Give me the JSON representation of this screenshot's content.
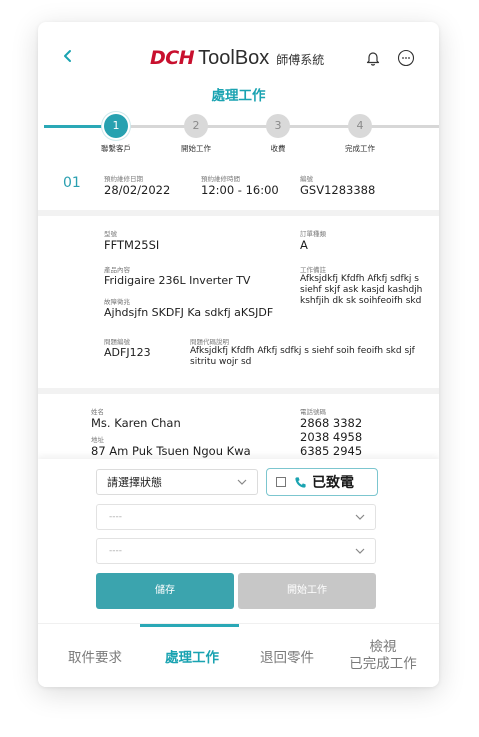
{
  "header": {
    "brand_dch": "DCH",
    "brand_toolbox": "ToolBox",
    "brand_sub": "師傅系統",
    "title": "處理工作"
  },
  "stepper": {
    "current": 1,
    "steps": [
      {
        "num": "1",
        "label": "聯繫客戶"
      },
      {
        "num": "2",
        "label": "開始工作"
      },
      {
        "num": "3",
        "label": "收費"
      },
      {
        "num": "4",
        "label": "完成工作"
      }
    ]
  },
  "job": {
    "index": "01",
    "date_label": "預約維修日期",
    "date": "28/02/2022",
    "time_label": "預約維修時間",
    "time": "12:00 - 16:00",
    "code_label": "編號",
    "code": "GSV1283388"
  },
  "product": {
    "model_label": "型號",
    "model": "FFTM25SI",
    "order_type_label": "訂單種類",
    "order_type": "A",
    "name_label": "產品內容",
    "name": "Fridigaire 236L Inverter TV",
    "work_note_label": "工作備註",
    "work_note": "Afksjdkfj Kfdfh Afkfj sdfkj s siehf skjf ask kasjd kashdjh kshfjih dk sk soihfeoifh skd",
    "fault_label": "故障徵兆",
    "fault": "Ajhdsjfn SKDFJ Ka sdkfj aKSJDF",
    "issue_code_label": "問題編號",
    "issue_code": "ADFJ123",
    "issue_desc_label": "問題代碼說明",
    "issue_desc": "Afksjdkfj Kfdfh Afkfj sdfkj s siehf soih feoifh skd sjf sitritu wojr sd"
  },
  "customer": {
    "name_label": "姓名",
    "name": "Ms. Karen Chan",
    "phone_label": "電話號碼",
    "phones": [
      "2868 3382",
      "2038 4958",
      "6385 2945"
    ],
    "address_label": "地址",
    "address": "87 Am Puk Tsuen Ngou Kwa"
  },
  "form": {
    "status_placeholder": "請選擇狀態",
    "call_label": "已致電",
    "select2": "----",
    "select3": "----",
    "save": "儲存",
    "start": "開始工作"
  },
  "nav": {
    "tab1": "取件要求",
    "tab2": "處理工作",
    "tab3": "退回零件",
    "tab4_line1": "檢視",
    "tab4_line2": "已完成工作",
    "active": "tab2"
  },
  "colors": {
    "accent": "#1aa3b1",
    "brand_red": "#c8102e",
    "save_button": "#3ba4ae",
    "disabled_button": "#c7c7c7"
  },
  "icons": [
    "back-chevron-icon",
    "bell-icon",
    "more-dots-icon",
    "chevron-down-icon",
    "phone-icon"
  ]
}
